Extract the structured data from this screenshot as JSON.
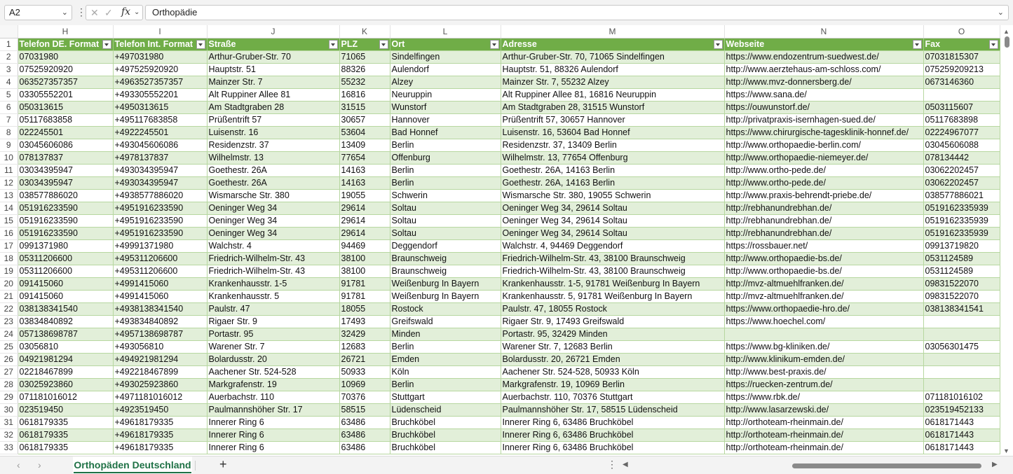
{
  "formula_bar": {
    "name_box": "A2",
    "formula": "Orthopädie",
    "fx_label": "fx",
    "cancel_icon": "close-icon",
    "confirm_icon": "check-icon"
  },
  "column_letters": [
    "H",
    "I",
    "J",
    "K",
    "L",
    "M",
    "N",
    "O"
  ],
  "headers": [
    "Telefon DE. Format",
    "Telefon Int. Format",
    "Straße",
    "PLZ",
    "Ort",
    "Adresse",
    "Webseite",
    "Fax"
  ],
  "rows": [
    [
      "2",
      "07031980",
      "+497031980",
      "Arthur-Gruber-Str. 70",
      "71065",
      "Sindelfingen",
      "Arthur-Gruber-Str. 70, 71065 Sindelfingen",
      "https://www.endozentrum-suedwest.de/",
      "07031815307"
    ],
    [
      "3",
      "07525920920",
      "+497525920920",
      "Hauptstr. 51",
      "88326",
      "Aulendorf",
      "Hauptstr. 51, 88326 Aulendorf",
      "http://www.aerztehaus-am-schloss.com/",
      "075259209213"
    ],
    [
      "4",
      "063527357357",
      "+4963527357357",
      "Mainzer Str. 7",
      "55232",
      "Alzey",
      "Mainzer Str. 7, 55232 Alzey",
      "http://www.mvz-donnersberg.de/",
      "0673146360"
    ],
    [
      "5",
      "03305552201",
      "+493305552201",
      "Alt Ruppiner Allee 81",
      "16816",
      "Neuruppin",
      "Alt Ruppiner Allee 81, 16816 Neuruppin",
      "https://www.sana.de/",
      ""
    ],
    [
      "6",
      "050313615",
      "+4950313615",
      "Am Stadtgraben 28",
      "31515",
      "Wunstorf",
      "Am Stadtgraben 28, 31515 Wunstorf",
      "https://ouwunstorf.de/",
      "0503115607"
    ],
    [
      "7",
      "05117683858",
      "+495117683858",
      "Prüßentrift 57",
      "30657",
      "Hannover",
      "Prüßentrift 57, 30657 Hannover",
      "http://privatpraxis-isernhagen-sued.de/",
      "05117683898"
    ],
    [
      "8",
      "022245501",
      "+4922245501",
      "Luisenstr. 16",
      "53604",
      "Bad Honnef",
      "Luisenstr. 16, 53604 Bad Honnef",
      "https://www.chirurgische-tagesklinik-honnef.de/",
      "02224967077"
    ],
    [
      "9",
      "03045606086",
      "+493045606086",
      "Residenzstr. 37",
      "13409",
      "Berlin",
      "Residenzstr. 37, 13409 Berlin",
      "http://www.orthopaedie-berlin.com/",
      "03045606088"
    ],
    [
      "10",
      "078137837",
      "+4978137837",
      "Wilhelmstr. 13",
      "77654",
      "Offenburg",
      "Wilhelmstr. 13, 77654 Offenburg",
      "http://www.orthopaedie-niemeyer.de/",
      "078134442"
    ],
    [
      "11",
      "03034395947",
      "+493034395947",
      "Goethestr. 26A",
      "14163",
      "Berlin",
      "Goethestr. 26A, 14163 Berlin",
      "http://www.ortho-pede.de/",
      "03062202457"
    ],
    [
      "12",
      "03034395947",
      "+493034395947",
      "Goethestr. 26A",
      "14163",
      "Berlin",
      "Goethestr. 26A, 14163 Berlin",
      "http://www.ortho-pede.de/",
      "03062202457"
    ],
    [
      "13",
      "038577886020",
      "+4938577886020",
      "Wismarsche Str. 380",
      "19055",
      "Schwerin",
      "Wismarsche Str. 380, 19055 Schwerin",
      "http://www.praxis-behrendt-priebe.de/",
      "038577886021"
    ],
    [
      "14",
      "051916233590",
      "+4951916233590",
      "Oeninger Weg 34",
      "29614",
      "Soltau",
      "Oeninger Weg 34, 29614 Soltau",
      "http://rebhanundrebhan.de/",
      "0519162335939"
    ],
    [
      "15",
      "051916233590",
      "+4951916233590",
      "Oeninger Weg 34",
      "29614",
      "Soltau",
      "Oeninger Weg 34, 29614 Soltau",
      "http://rebhanundrebhan.de/",
      "0519162335939"
    ],
    [
      "16",
      "051916233590",
      "+4951916233590",
      "Oeninger Weg 34",
      "29614",
      "Soltau",
      "Oeninger Weg 34, 29614 Soltau",
      "http://rebhanundrebhan.de/",
      "0519162335939"
    ],
    [
      "17",
      "0991371980",
      "+49991371980",
      "Walchstr. 4",
      "94469",
      "Deggendorf",
      "Walchstr. 4, 94469 Deggendorf",
      "https://rossbauer.net/",
      "09913719820"
    ],
    [
      "18",
      "05311206600",
      "+495311206600",
      "Friedrich-Wilhelm-Str. 43",
      "38100",
      "Braunschweig",
      "Friedrich-Wilhelm-Str. 43, 38100 Braunschweig",
      "http://www.orthopaedie-bs.de/",
      "0531124589"
    ],
    [
      "19",
      "05311206600",
      "+495311206600",
      "Friedrich-Wilhelm-Str. 43",
      "38100",
      "Braunschweig",
      "Friedrich-Wilhelm-Str. 43, 38100 Braunschweig",
      "http://www.orthopaedie-bs.de/",
      "0531124589"
    ],
    [
      "20",
      "091415060",
      "+4991415060",
      "Krankenhausstr. 1-5",
      "91781",
      "Weißenburg In Bayern",
      "Krankenhausstr. 1-5, 91781 Weißenburg In Bayern",
      "http://mvz-altmuehlfranken.de/",
      "09831522070"
    ],
    [
      "21",
      "091415060",
      "+4991415060",
      "Krankenhausstr. 5",
      "91781",
      "Weißenburg In Bayern",
      "Krankenhausstr. 5, 91781 Weißenburg In Bayern",
      "http://mvz-altmuehlfranken.de/",
      "09831522070"
    ],
    [
      "22",
      "038138341540",
      "+4938138341540",
      "Paulstr. 47",
      "18055",
      "Rostock",
      "Paulstr. 47, 18055 Rostock",
      "https://www.orthopaedie-hro.de/",
      "038138341541"
    ],
    [
      "23",
      "03834840892",
      "+493834840892",
      "Rigaer Str. 9",
      "17493",
      "Greifswald",
      "Rigaer Str. 9, 17493 Greifswald",
      "https://www.hoechel.com/",
      ""
    ],
    [
      "24",
      "057138698787",
      "+4957138698787",
      "Portastr. 95",
      "32429",
      "Minden",
      "Portastr. 95, 32429 Minden",
      "",
      ""
    ],
    [
      "25",
      "03056810",
      "+493056810",
      "Warener Str. 7",
      "12683",
      "Berlin",
      "Warener Str. 7, 12683 Berlin",
      "https://www.bg-kliniken.de/",
      "03056301475"
    ],
    [
      "26",
      "04921981294",
      "+494921981294",
      "Bolardusstr. 20",
      "26721",
      "Emden",
      "Bolardusstr. 20, 26721 Emden",
      "http://www.klinikum-emden.de/",
      ""
    ],
    [
      "27",
      "02218467899",
      "+492218467899",
      "Aachener Str. 524-528",
      "50933",
      "Köln",
      "Aachener Str. 524-528, 50933 Köln",
      "http://www.best-praxis.de/",
      ""
    ],
    [
      "28",
      "03025923860",
      "+493025923860",
      "Markgrafenstr. 19",
      "10969",
      "Berlin",
      "Markgrafenstr. 19, 10969 Berlin",
      "https://ruecken-zentrum.de/",
      ""
    ],
    [
      "29",
      "071181016012",
      "+4971181016012",
      "Auerbachstr. 110",
      "70376",
      "Stuttgart",
      "Auerbachstr. 110, 70376 Stuttgart",
      "https://www.rbk.de/",
      "071181016102"
    ],
    [
      "30",
      "023519450",
      "+4923519450",
      "Paulmannshöher Str. 17",
      "58515",
      "Lüdenscheid",
      "Paulmannshöher Str. 17, 58515 Lüdenscheid",
      "http://www.lasarzewski.de/",
      "023519452133"
    ],
    [
      "31",
      "0618179335",
      "+49618179335",
      "Innerer Ring 6",
      "63486",
      "Bruchköbel",
      "Innerer Ring 6, 63486 Bruchköbel",
      "http://orthoteam-rheinmain.de/",
      "0618171443"
    ],
    [
      "32",
      "0618179335",
      "+49618179335",
      "Innerer Ring 6",
      "63486",
      "Bruchköbel",
      "Innerer Ring 6, 63486 Bruchköbel",
      "http://orthoteam-rheinmain.de/",
      "0618171443"
    ],
    [
      "33",
      "0618179335",
      "+49618179335",
      "Innerer Ring 6",
      "63486",
      "Bruchköbel",
      "Innerer Ring 6, 63486 Bruchköbel",
      "http://orthoteam-rheinmain.de/",
      "0618171443"
    ]
  ],
  "sheet_tab": "Orthopäden Deutschland",
  "add_sheet": "+",
  "colors": {
    "header_green": "#70ad47",
    "band_green": "#e2efd9",
    "accent": "#1e7145"
  }
}
